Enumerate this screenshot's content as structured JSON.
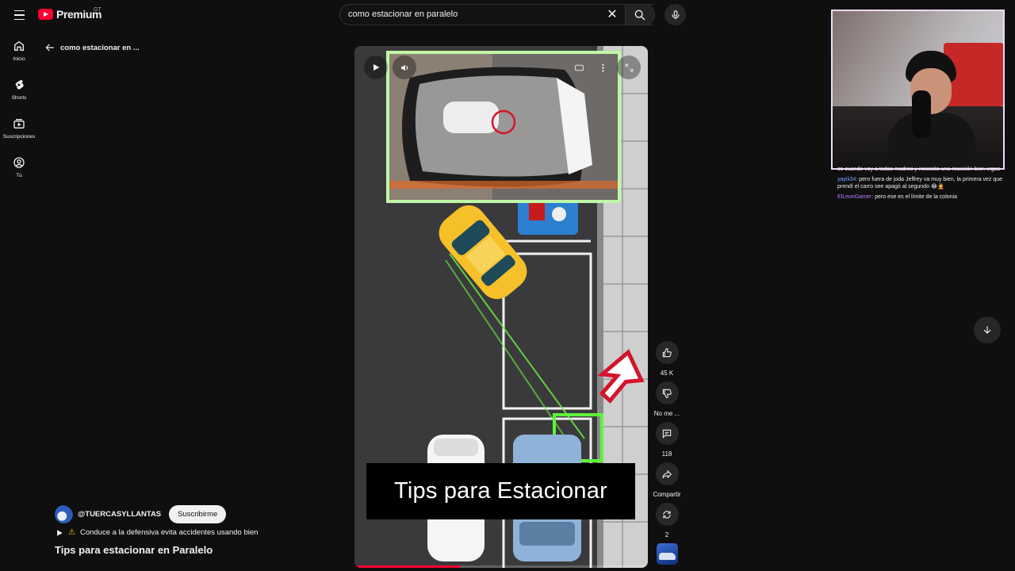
{
  "header": {
    "logo_text": "Premium",
    "country_code": "GT",
    "search_value": "como estacionar en paralelo"
  },
  "rail": {
    "items": [
      {
        "label": "Inicio",
        "icon": "home-icon"
      },
      {
        "label": "Shorts",
        "icon": "shorts-icon"
      },
      {
        "label": "Suscripciones",
        "icon": "subscriptions-icon"
      },
      {
        "label": "Tú",
        "icon": "account-icon"
      }
    ]
  },
  "back_nav": {
    "label": "como estacionar en ..."
  },
  "video": {
    "overlay_caption": "Tips para Estacionar",
    "progress_fraction": 0.36
  },
  "actions": {
    "likes": "45 K",
    "dislike_label": "No me ...",
    "comments": "118",
    "share_label": "Compartir",
    "remix_count": "2"
  },
  "channel": {
    "handle": "@TUERCASYLLANTAS",
    "subscribe_label": "Suscribirme",
    "description": "Conduce a la defensiva evita accidentes usando bien",
    "title": "Tips para estacionar en Paralelo"
  },
  "chat": {
    "messages": [
      {
        "user": "",
        "text": "es cuando voy a todas madres y necesito una reacción bien vrgas"
      },
      {
        "user": "yayiii34:",
        "text": "pero fuera de joda Jeffrey va muy bien, la primera vez que prendí el carro see apagó al segundo 😂🤦"
      },
      {
        "user": "ElLeonGamer:",
        "text": "pero ese es el límite de la colonia"
      }
    ]
  },
  "colors": {
    "background": "#0f0f0f",
    "brand_red": "#ff0033",
    "highlight_green": "#7dff5a",
    "car_yellow": "#f5c02a"
  }
}
